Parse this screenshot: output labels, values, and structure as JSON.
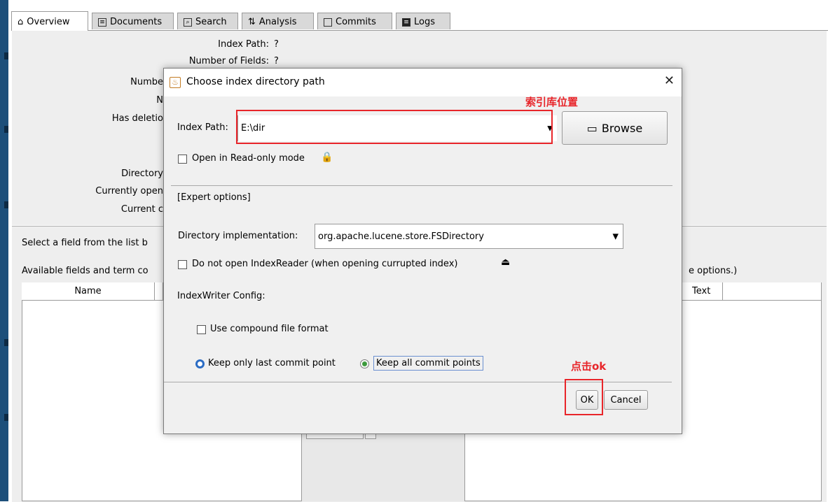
{
  "tabs": [
    {
      "label": "Overview",
      "icon": "home-icon"
    },
    {
      "label": "Documents",
      "icon": "document-icon"
    },
    {
      "label": "Search",
      "icon": "search-icon"
    },
    {
      "label": "Analysis",
      "icon": "analysis-icon"
    },
    {
      "label": "Commits",
      "icon": "commits-icon"
    },
    {
      "label": "Logs",
      "icon": "logs-icon"
    }
  ],
  "overview": {
    "index_path_label": "Index Path:",
    "index_path_value": "?",
    "num_fields_label": "Number of Fields:",
    "num_fields_value": "?",
    "num_docs_label": "Numbe",
    "num_terms_label": "N",
    "has_deletions_label": "Has deletio",
    "directory_label": "Directory",
    "currently_open_label": "Currently open",
    "current_commit_label": "Current c"
  },
  "lower": {
    "select_field_text": "Select a field from the list b",
    "available_fields_text": "Available fields and term co",
    "options_hint": "e options.)",
    "col_name": "Name",
    "col_text": "Text"
  },
  "dialog": {
    "title": "Choose index directory path",
    "close_glyph": "✕",
    "index_path_label": "Index Path:",
    "index_path_value": "E:\\dir",
    "browse_label": "Browse",
    "readonly_label": "Open in Read-only mode",
    "expert_options": "[Expert options]",
    "dir_impl_label": "Directory implementation:",
    "dir_impl_value": "org.apache.lucene.store.FSDirectory",
    "no_reader_label": "Do not open IndexReader (when opening currupted index)",
    "iw_config_label": "IndexWriter Config:",
    "compound_label": "Use compound file format",
    "keep_last_label": "Keep only last commit point",
    "keep_all_label": "Keep all commit points",
    "ok_label": "OK",
    "cancel_label": "Cancel",
    "readonly_checked": false,
    "no_reader_checked": false,
    "compound_checked": false,
    "selected_commit_option": "keep_all"
  },
  "annotations": {
    "index_location": "索引库位置",
    "click_ok": "点击ok"
  },
  "colors": {
    "annotation_red": "#e8252a",
    "sidebar_blue": "#1d4f7a"
  }
}
